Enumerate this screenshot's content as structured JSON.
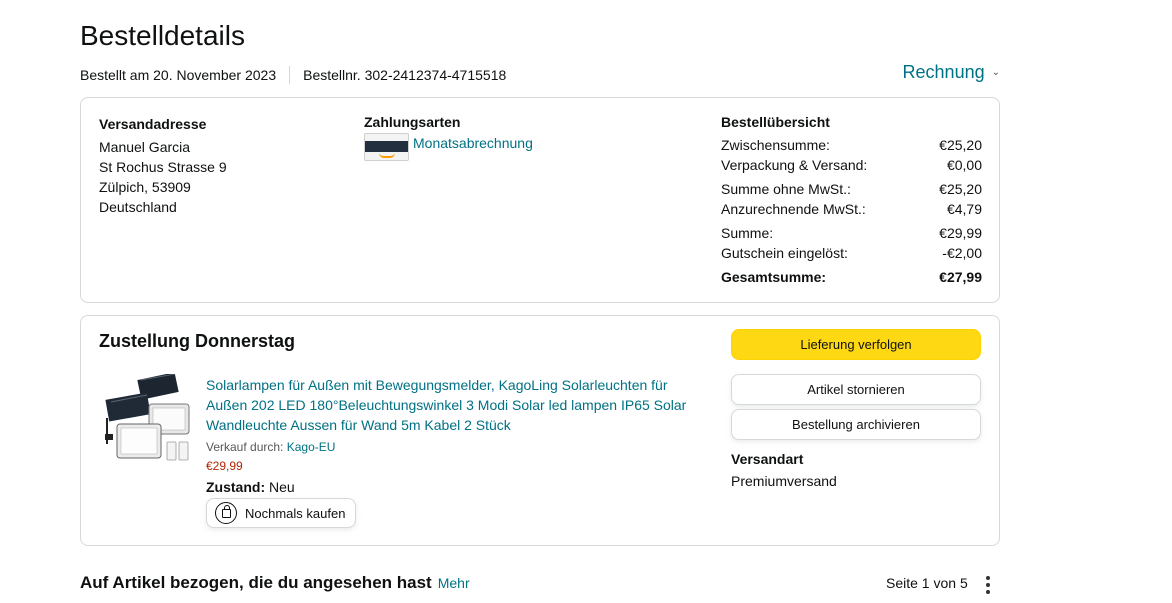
{
  "page": {
    "title": "Bestelldetails",
    "ordered_on": "Bestellt am 20. November 2023",
    "order_number": "Bestellnr. 302-2412374-4715518",
    "invoice_label": "Rechnung"
  },
  "shipping_address": {
    "heading": "Versandadresse",
    "name": "Manuel Garcia",
    "street": "St Rochus Strasse 9",
    "city": "Zülpich, 53909",
    "country": "Deutschland"
  },
  "payment": {
    "heading": "Zahlungsarten",
    "method": "Monatsabrechnung"
  },
  "order_summary": {
    "heading": "Bestellübersicht",
    "rows": [
      {
        "label": "Zwischensumme:",
        "value": "€25,20"
      },
      {
        "label": "Verpackung & Versand:",
        "value": "€0,00"
      },
      {
        "label": "Summe ohne MwSt.:",
        "value": "€25,20"
      },
      {
        "label": "Anzurechnende MwSt.:",
        "value": "€4,79"
      },
      {
        "label": "Summe:",
        "value": "€29,99"
      },
      {
        "label": "Gutschein eingelöst:",
        "value": "-€2,00"
      },
      {
        "label": "Gesamtsumme:",
        "value": "€27,99"
      }
    ]
  },
  "delivery": {
    "heading": "Zustellung Donnerstag",
    "product_title": "Solarlampen für Außen mit Bewegungsmelder, KagoLing Solarleuchten für Außen 202 LED 180°Beleuchtungswinkel 3 Modi Solar led lampen IP65 Solar Wandleuchte Aussen für Wand 5m Kabel 2 Stück",
    "sold_by_label": "Verkauf durch:",
    "seller": "Kago-EU",
    "price": "€29,99",
    "condition_label": "Zustand:",
    "condition_value": "Neu",
    "rebuy_label": "Nochmals kaufen",
    "track_label": "Lieferung verfolgen",
    "cancel_label": "Artikel stornieren",
    "archive_label": "Bestellung archivieren",
    "shipping_type_heading": "Versandart",
    "shipping_type_value": "Premiumversand"
  },
  "related": {
    "heading": "Auf Artikel bezogen, die du angesehen hast",
    "more_link": "Mehr",
    "pager": "Seite 1 von 5"
  },
  "colors": {
    "link": "#007185",
    "primary_button": "#ffd814",
    "price": "#b12704",
    "border": "#d5d9d9"
  },
  "icons": [
    "chevron-down-icon",
    "amazon-card-icon",
    "rebuy-icon",
    "more-options-icon"
  ]
}
